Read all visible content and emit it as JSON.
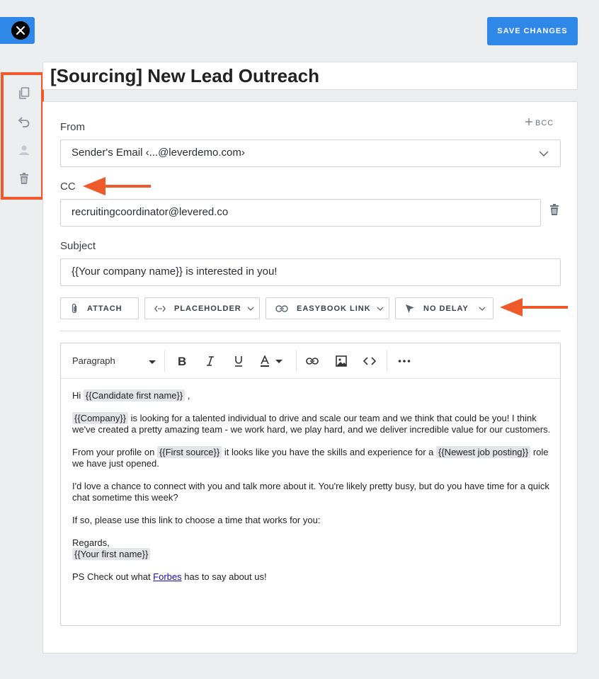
{
  "header": {
    "save_label": "SAVE CHANGES"
  },
  "template": {
    "title": "[Sourcing] New Lead Outreach"
  },
  "form": {
    "from_label": "From",
    "from_value": "Sender's Email ‹...@leverdemo.com›",
    "bcc_label": "BCC",
    "cc_label": "CC",
    "cc_value": "recruitingcoordinator@levered.co",
    "subject_label": "Subject",
    "subject_value": "{{Your company name}} is interested in you!"
  },
  "toolbar": {
    "attach": "ATTACH",
    "placeholder": "PLACEHOLDER",
    "easybook": "EASYBOOK LINK",
    "delay": "NO DELAY"
  },
  "editor": {
    "format": "Paragraph",
    "body": {
      "greeting": "Hi",
      "candidate_tag": "{{Candidate first name}}",
      "greeting_end": ",",
      "company_tag": "{{Company}}",
      "p1_text": " is looking for a talented individual to drive and scale our team and we think that could be you! I think we've created a pretty amazing team - we work hard, we play hard, and we deliver incredible value for our customers.",
      "p2_a": "From your profile on ",
      "source_tag": "{{First source}}",
      "p2_b": " it looks like you have the skills and experience for a ",
      "job_tag": "{{Newest job posting}}",
      "p2_c": " role we have just opened.",
      "p3": "I'd love a chance to connect with you and talk more about it. You're likely pretty busy, but do you have time for a quick chat sometime this week?",
      "p4": "If so, please use this link to choose a time that works for you:",
      "regards": "Regards,",
      "name_tag": "{{Your first name}}",
      "ps_a": "PS Check out what ",
      "ps_link": "Forbes",
      "ps_b": " has to say about us!"
    }
  },
  "colors": {
    "primary": "#2f87e8",
    "annotation": "#ef5a2a",
    "chip": "#e4e5e8"
  },
  "icons": [
    "close-icon",
    "copy-icon",
    "undo-icon",
    "user-icon",
    "trash-icon",
    "plus-icon",
    "chevron-down-icon",
    "paperclip-icon",
    "code-icon",
    "link-icon",
    "cursor-icon",
    "bold-icon",
    "italic-icon",
    "underline-icon",
    "text-color-icon",
    "image-icon",
    "more-icon"
  ]
}
